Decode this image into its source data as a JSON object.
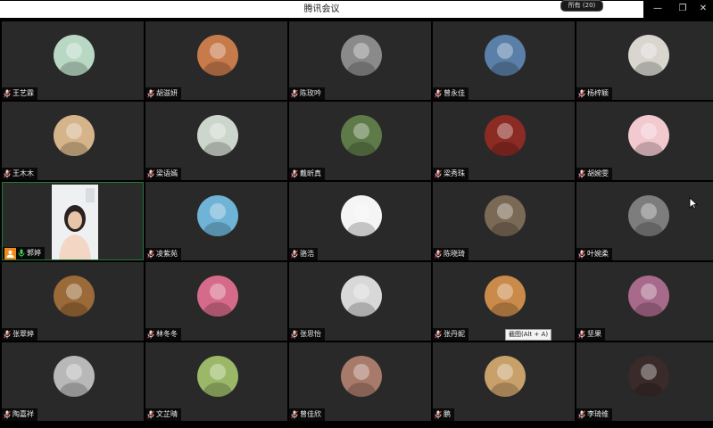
{
  "window": {
    "title": "腾讯会议",
    "participants_label": "所有 (20)",
    "minimize": "—",
    "restore": "❐",
    "close": "✕"
  },
  "tooltip": "截图(Alt + A)",
  "participants": [
    {
      "name": "王艺霖",
      "avatar": "cartoon-dog-avatar",
      "color": "#b9d8c4"
    },
    {
      "name": "胡滋妍",
      "avatar": "red-panda-avatar",
      "color": "#c77a4a"
    },
    {
      "name": "陈玫吟",
      "avatar": "bw-photo-avatar",
      "color": "#8a8a8a"
    },
    {
      "name": "曾永佳",
      "avatar": "anime-boy-avatar",
      "color": "#5a7fa8"
    },
    {
      "name": "杨梓颖",
      "avatar": "bird-avatar",
      "color": "#d9d6cf"
    },
    {
      "name": "王木木",
      "avatar": "child-photo-avatar",
      "color": "#d6b48a"
    },
    {
      "name": "梁语嫣",
      "avatar": "plant-avatar",
      "color": "#cdd6cc"
    },
    {
      "name": "戴昕真",
      "avatar": "landscape-avatar",
      "color": "#5d7a48"
    },
    {
      "name": "梁秀珠",
      "avatar": "girl-red-avatar",
      "color": "#8c2a24"
    },
    {
      "name": "胡婉雯",
      "avatar": "pink-cartoon-avatar",
      "color": "#f2c9cf"
    },
    {
      "name": "郭婷",
      "avatar": "video-feed",
      "color": "#eef0f2"
    },
    {
      "name": "凌紫苑",
      "avatar": "doraemon-avatar",
      "color": "#6fb3d6"
    },
    {
      "name": "骆浩",
      "avatar": "sheep-avatar",
      "color": "#f5f5f5"
    },
    {
      "name": "陈晓琦",
      "avatar": "girl-photo-avatar",
      "color": "#7a6a55"
    },
    {
      "name": "叶婉柔",
      "avatar": "pink-sign-avatar",
      "color": "#7d7d7d"
    },
    {
      "name": "张翠婷",
      "avatar": "teddy-bear-avatar",
      "color": "#9a6a38"
    },
    {
      "name": "林冬冬",
      "avatar": "anime-girl-avatar",
      "color": "#d66a8a"
    },
    {
      "name": "张思怡",
      "avatar": "sketch-avatar",
      "color": "#d8d8d8"
    },
    {
      "name": "张丹妮",
      "avatar": "sunset-avatar",
      "color": "#c98a4a"
    },
    {
      "name": "坚果",
      "avatar": "comic-avatar",
      "color": "#a86a8a"
    },
    {
      "name": "陶嘉祥",
      "avatar": "cat-avatar",
      "color": "#b8b8b8"
    },
    {
      "name": "文芷晴",
      "avatar": "yellow-dress-avatar",
      "color": "#9ab868"
    },
    {
      "name": "曾佳欣",
      "avatar": "bread-avatar",
      "color": "#a87a6a"
    },
    {
      "name": "鹏",
      "avatar": "food-bowl-avatar",
      "color": "#c8a06a"
    },
    {
      "name": "李琦维",
      "avatar": "dark-anime-avatar",
      "color": "#3a2a2a"
    }
  ]
}
